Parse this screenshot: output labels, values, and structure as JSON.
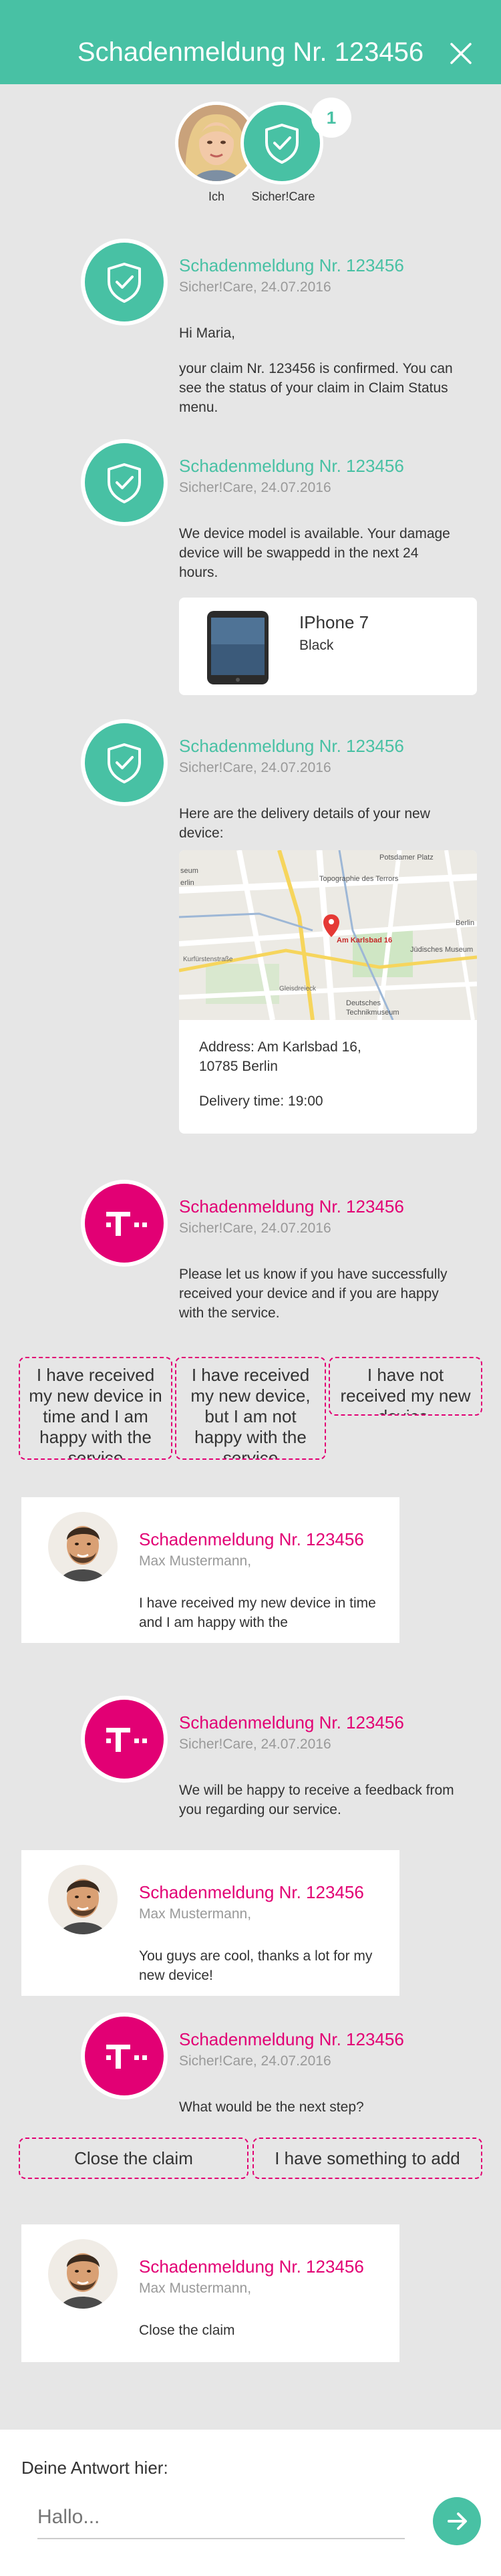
{
  "header": {
    "title": "Schadenmeldung Nr. 123456"
  },
  "participants": [
    {
      "label": "Ich"
    },
    {
      "label": "Sicher!Care"
    }
  ],
  "badge_count": "1",
  "messages": [
    {
      "title": "Schadenmeldung Nr. 123456",
      "sub": "Sicher!Care, 24.07.2016",
      "greeting": "Hi Maria,",
      "body": "your claim Nr. 123456 is confirmed. You can see the status of your claim in Claim Status menu."
    },
    {
      "title": "Schadenmeldung Nr. 123456",
      "sub": "Sicher!Care, 24.07.2016",
      "body": "We device model is available. Your damage device will be swappedd in the next 24 hours."
    },
    {
      "title": "Schadenmeldung Nr. 123456",
      "sub": "Sicher!Care, 24.07.2016",
      "body": "Here are the delivery details of your new device:"
    },
    {
      "title": "Schadenmeldung Nr. 123456",
      "sub": "Sicher!Care, 24.07.2016",
      "body": "Please let us know if you have successfully received your device and if you are happy with the service."
    },
    {
      "title": "Schadenmeldung Nr. 123456",
      "sub": "Sicher!Care, 24.07.2016",
      "body": "We will be happy to receive a feedback from you regarding our service."
    },
    {
      "title": "Schadenmeldung Nr. 123456",
      "sub": "Sicher!Care, 24.07.2016",
      "body": "What would be the next step?"
    }
  ],
  "device": {
    "name": "IPhone 7",
    "color": "Black"
  },
  "map": {
    "labels": [
      "Potsdamer Platz",
      "seum",
      "erlin",
      "Topographie des Terrors",
      "Am Karlsbad 16",
      "Berlin",
      "Jüdisches Museum",
      "Deutsches",
      "Technikmuseum",
      "Kurfürstenstraße",
      "Gleisdreieck"
    ]
  },
  "delivery": {
    "address": "Address: Am Karlsbad 16, 10785 Berlin",
    "time": "Delivery time: 19:00"
  },
  "options_first": [
    "I have received my new device in time and I am happy with the service",
    "I have received my new device, but I am not happy with the service",
    "I have not received my new device."
  ],
  "options_second": [
    "Close the claim",
    "I have something to add"
  ],
  "replies": [
    {
      "title": "Schadenmeldung Nr. 123456",
      "sub": "Max Mustermann,",
      "body": "I have received my new device in time and I am happy with the"
    },
    {
      "title": "Schadenmeldung Nr. 123456",
      "sub": "Max Mustermann,",
      "body": "You guys are cool, thanks a lot for my new device!"
    },
    {
      "title": "Schadenmeldung Nr. 123456",
      "sub": "Max Mustermann,",
      "body": "Close the claim"
    }
  ],
  "footer": {
    "label": "Deine Antwort hier:",
    "placeholder": "Hallo..."
  },
  "colors": {
    "teal": "#48c1a4",
    "magenta": "#e20074",
    "background": "#e6e6e6"
  },
  "icons": {
    "close": "close-icon",
    "shield": "shield-check-icon",
    "telekom": "telekom-logo-icon",
    "send": "send-arrow-icon",
    "pin": "map-pin-icon"
  }
}
